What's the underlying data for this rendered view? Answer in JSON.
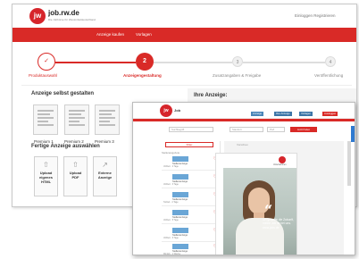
{
  "back_window": {
    "brand": "job.rw.de",
    "brand_sub": "Die Jobbörse für Westmitteldeutschland",
    "login": "Einloggen  Registrieren",
    "nav": [
      "Anzeige kaufen",
      "Vorlagen"
    ],
    "steps": [
      {
        "num": "✓",
        "label": "Produktauswahl",
        "state": "done"
      },
      {
        "num": "2",
        "label": "Anzeigengestaltung",
        "state": "active"
      },
      {
        "num": "3",
        "label": "Zusatzangaben & Freigabe",
        "state": "todo"
      },
      {
        "num": "4",
        "label": "Veröffentlichung",
        "state": "todo"
      }
    ],
    "section1_title": "Anzeige selbst gestalten",
    "templates": [
      "Premium 1",
      "Premium 2",
      "Premium 3"
    ],
    "section2_title": "Fertige Anzeige auswählen",
    "uploads": [
      {
        "icon": "upload-icon",
        "label": "Upload\neigenes\nHTML"
      },
      {
        "icon": "upload-icon",
        "label": "Upload\nPDF"
      },
      {
        "icon": "external-link-icon",
        "label": "Externe\nAnzeige"
      }
    ],
    "preview_title": "Ihre Anzeige:"
  },
  "front_window": {
    "brand": "Job",
    "top_buttons": [
      "Anzeige",
      "Ihre Anzeige",
      "Vorlagen",
      "Ausloggen"
    ],
    "search_placeholder": "Suchbegriff",
    "location_value": "Standort",
    "zip_value": "PLZ",
    "search_button": "Jetzt finden",
    "filter_button": "Filter",
    "list_header": "Stellenangebote",
    "list_items": [
      {
        "title": "Stellenanzeige",
        "meta": "Vollzeit · 2 Tage"
      },
      {
        "title": "Stellenanzeige",
        "meta": "Vollzeit · 3 Tage"
      },
      {
        "title": "Stellenanzeige",
        "meta": "Teilzeit · 4 Tage"
      },
      {
        "title": "Stellenanzeige",
        "meta": "Vollzeit · 5 Tage"
      },
      {
        "title": "Stellenanzeige",
        "meta": "Vollzeit · 6 Tage"
      },
      {
        "title": "Stellenanzeige",
        "meta": "Minijob · 1 Woche"
      }
    ],
    "preview_label": "Vorschau",
    "ad_logo_text": "Unternehmen",
    "ad_quote_lines": [
      "Ich gestalte die Zukunft,",
      "meine Job ist bei uns.",
      "www.jobs.de"
    ]
  },
  "colors": {
    "brand_red": "#d92a27",
    "accent_blue": "#2f7ad0"
  }
}
